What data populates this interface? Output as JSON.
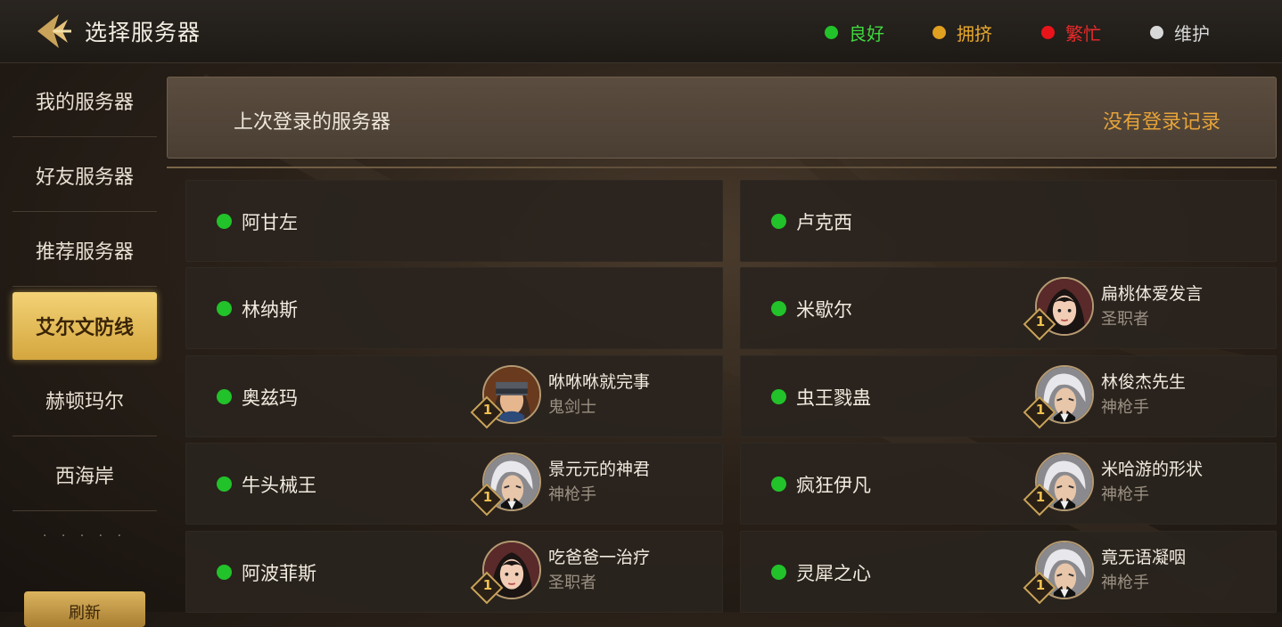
{
  "header": {
    "title": "选择服务器",
    "legend": [
      {
        "label": "良好",
        "color": "#22c22a"
      },
      {
        "label": "拥挤",
        "color": "#e0a020"
      },
      {
        "label": "繁忙",
        "color": "#e8141a"
      },
      {
        "label": "维护",
        "color": "#d8d8d8"
      }
    ]
  },
  "sidebar": {
    "items": [
      {
        "label": "我的服务器"
      },
      {
        "label": "好友服务器"
      },
      {
        "label": "推荐服务器"
      },
      {
        "label": "艾尔文防线",
        "active": true
      },
      {
        "label": "赫顿玛尔"
      },
      {
        "label": "西海岸"
      },
      {
        "label": "· · ·  ·  ·"
      }
    ],
    "refresh_label": "刷新"
  },
  "last_login": {
    "label": "上次登录的服务器",
    "value": "没有登录记录"
  },
  "servers": [
    {
      "name": "阿甘左",
      "status": "良好"
    },
    {
      "name": "卢克西",
      "status": "良好"
    },
    {
      "name": "林纳斯",
      "status": "良好"
    },
    {
      "name": "米歇尔",
      "status": "良好",
      "character": {
        "name": "扁桃体爱发言",
        "class": "圣职者",
        "level": "1",
        "portrait": "priest"
      }
    },
    {
      "name": "奥兹玛",
      "status": "良好",
      "character": {
        "name": "咻咻咻就完事",
        "class": "鬼剑士",
        "level": "1",
        "portrait": "slayer"
      }
    },
    {
      "name": "虫王戮蛊",
      "status": "良好",
      "character": {
        "name": "林俊杰先生",
        "class": "神枪手",
        "level": "1",
        "portrait": "gunner"
      }
    },
    {
      "name": "牛头械王",
      "status": "良好",
      "character": {
        "name": "景元元的神君",
        "class": "神枪手",
        "level": "1",
        "portrait": "gunner"
      }
    },
    {
      "name": "疯狂伊凡",
      "status": "良好",
      "character": {
        "name": "米哈游的形状",
        "class": "神枪手",
        "level": "1",
        "portrait": "gunner"
      }
    },
    {
      "name": "阿波菲斯",
      "status": "良好",
      "character": {
        "name": "吃爸爸一治疗",
        "class": "圣职者",
        "level": "1",
        "portrait": "priest"
      }
    },
    {
      "name": "灵犀之心",
      "status": "良好",
      "character": {
        "name": "竟无语凝咽",
        "class": "神枪手",
        "level": "1",
        "portrait": "gunner"
      }
    }
  ]
}
